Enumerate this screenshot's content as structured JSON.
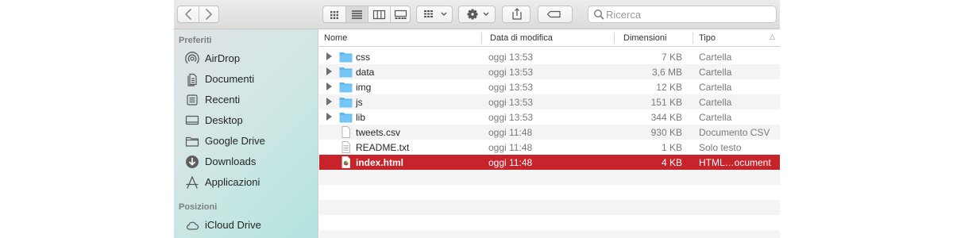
{
  "toolbar": {
    "search_placeholder": "Ricerca",
    "icons": [
      "chevron-left-icon",
      "chevron-right-icon",
      "icon-view-icon",
      "list-view-icon",
      "column-view-icon",
      "gallery-view-icon",
      "group-icon",
      "gear-icon",
      "share-icon",
      "tag-icon",
      "search-icon"
    ],
    "active_view": "list"
  },
  "sidebar": {
    "sections": [
      {
        "title": "Preferiti",
        "items": [
          {
            "label": "AirDrop",
            "icon": "airdrop-icon"
          },
          {
            "label": "Documenti",
            "icon": "documents-icon"
          },
          {
            "label": "Recenti",
            "icon": "recents-icon"
          },
          {
            "label": "Desktop",
            "icon": "desktop-icon"
          },
          {
            "label": "Google Drive",
            "icon": "folder-icon"
          },
          {
            "label": "Downloads",
            "icon": "downloads-icon"
          },
          {
            "label": "Applicazioni",
            "icon": "applications-icon"
          }
        ]
      },
      {
        "title": "Posizioni",
        "items": [
          {
            "label": "iCloud Drive",
            "icon": "cloud-icon"
          }
        ]
      }
    ]
  },
  "filelist": {
    "columns": {
      "name": "Nome",
      "date": "Data di modifica",
      "size": "Dimensioni",
      "kind": "Tipo"
    },
    "sort_column": "kind",
    "rows": [
      {
        "name": "css",
        "date": "oggi 13:53",
        "size": "7 KB",
        "kind": "Cartella",
        "type": "folder",
        "selected": false
      },
      {
        "name": "data",
        "date": "oggi 13:53",
        "size": "3,6 MB",
        "kind": "Cartella",
        "type": "folder",
        "selected": false
      },
      {
        "name": "img",
        "date": "oggi 13:53",
        "size": "12 KB",
        "kind": "Cartella",
        "type": "folder",
        "selected": false
      },
      {
        "name": "js",
        "date": "oggi 13:53",
        "size": "151 KB",
        "kind": "Cartella",
        "type": "folder",
        "selected": false
      },
      {
        "name": "lib",
        "date": "oggi 13:53",
        "size": "344 KB",
        "kind": "Cartella",
        "type": "folder",
        "selected": false
      },
      {
        "name": "tweets.csv",
        "date": "oggi 11:48",
        "size": "930 KB",
        "kind": "Documento CSV",
        "type": "file",
        "selected": false
      },
      {
        "name": "README.txt",
        "date": "oggi 11:48",
        "size": "1 KB",
        "kind": "Solo testo",
        "type": "text",
        "selected": false
      },
      {
        "name": "index.html",
        "date": "oggi 11:48",
        "size": "4 KB",
        "kind": "HTML…ocument",
        "type": "html",
        "selected": true
      }
    ]
  },
  "colors": {
    "selection": "#c6232b",
    "folder": "#5cb8ef",
    "sidebar_tint": "#b3e4df"
  }
}
